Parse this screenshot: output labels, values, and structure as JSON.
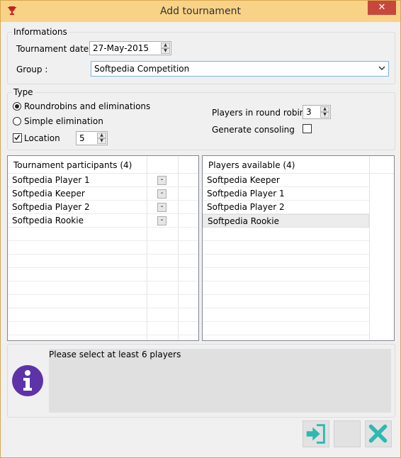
{
  "window": {
    "title": "Add tournament"
  },
  "informations": {
    "legend": "Informations",
    "date_label": "Tournament date :",
    "date_value": "27-May-2015",
    "group_label": "Group :",
    "group_value": "Softpedia Competition"
  },
  "type": {
    "legend": "Type",
    "option_roundrobin": "Roundrobins and eliminations",
    "option_simple": "Simple elimination",
    "selected": "Roundrobins and eliminations",
    "location_label": "Location",
    "location_checked": true,
    "location_value": "5",
    "players_rr_label": "Players in round robin :",
    "players_rr_value": "3",
    "consoling_label": "Generate consoling",
    "consoling_checked": false
  },
  "participants": {
    "header": "Tournament participants (4)",
    "remove_label": "-",
    "items": [
      "Softpedia Player 1",
      "Softpedia Keeper",
      "Softpedia Player 2",
      "Softpedia Rookie"
    ]
  },
  "available": {
    "header": "Players available (4)",
    "selected": "Softpedia Rookie",
    "items": [
      "Softpedia Keeper",
      "Softpedia Player 1",
      "Softpedia Player 2",
      "Softpedia Rookie"
    ]
  },
  "message": {
    "text": "Please select at least 6 players",
    "icon": "info-icon"
  },
  "buttons": {
    "ok_icon": "enter-icon",
    "cancel_icon": "close-x-icon"
  },
  "colors": {
    "titlebar": "#f8d287",
    "accent": "#2fb8b2",
    "info": "#5e33a8",
    "close": "#c7473d"
  }
}
